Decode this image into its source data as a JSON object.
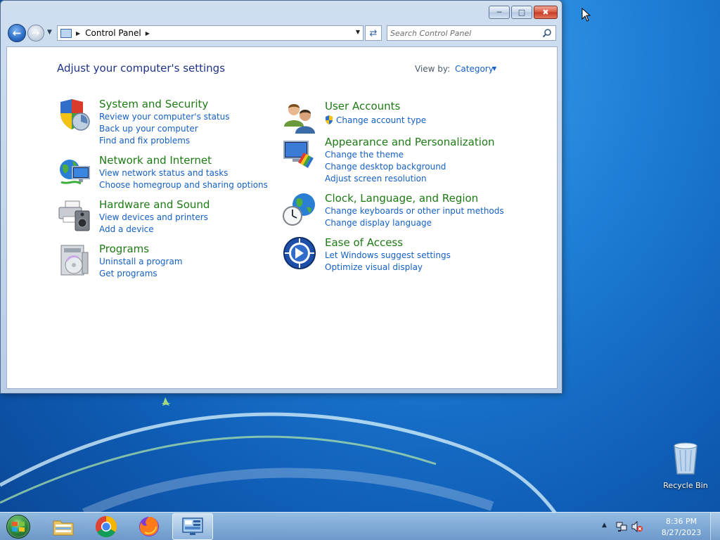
{
  "window": {
    "caption_buttons": {
      "minimize_icon": "minimize-icon",
      "maximize_icon": "maximize-icon",
      "close_icon": "close-icon"
    },
    "address": {
      "crumb": "Control Panel",
      "search_placeholder": "Search Control Panel"
    },
    "content": {
      "title": "Adjust your computer's settings",
      "view_by_label": "View by:",
      "view_by_value": "Category",
      "categories": [
        {
          "title": "System and Security",
          "icon": "shield-security-icon",
          "links": [
            "Review your computer's status",
            "Back up your computer",
            "Find and fix problems"
          ]
        },
        {
          "title": "Network and Internet",
          "icon": "network-globe-icon",
          "links": [
            "View network status and tasks",
            "Choose homegroup and sharing options"
          ]
        },
        {
          "title": "Hardware and Sound",
          "icon": "printer-speaker-icon",
          "links": [
            "View devices and printers",
            "Add a device"
          ]
        },
        {
          "title": "Programs",
          "icon": "programs-disc-icon",
          "links": [
            "Uninstall a program",
            "Get programs"
          ]
        },
        {
          "title": "User Accounts",
          "icon": "users-icon",
          "links": [
            "Change account type"
          ]
        },
        {
          "title": "Appearance and Personalization",
          "icon": "monitor-palette-icon",
          "links": [
            "Change the theme",
            "Change desktop background",
            "Adjust screen resolution"
          ]
        },
        {
          "title": "Clock, Language, and Region",
          "icon": "clock-globe-icon",
          "links": [
            "Change keyboards or other input methods",
            "Change display language"
          ]
        },
        {
          "title": "Ease of Access",
          "icon": "ease-of-access-icon",
          "links": [
            "Let Windows suggest settings",
            "Optimize visual display"
          ]
        }
      ]
    }
  },
  "desktop": {
    "recycle_bin_label": "Recycle Bin"
  },
  "taskbar": {
    "apps": [
      "Windows Explorer",
      "Google Chrome",
      "Firefox",
      "Control Panel"
    ],
    "clock_time": "8:36 PM",
    "clock_date": "8/27/2023"
  }
}
